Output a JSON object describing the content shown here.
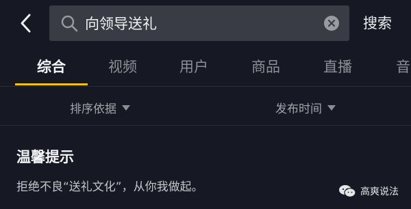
{
  "search": {
    "query": "向领导送礼",
    "button_label": "搜索"
  },
  "tabs": [
    {
      "label": "综合",
      "active": true
    },
    {
      "label": "视频",
      "active": false
    },
    {
      "label": "用户",
      "active": false
    },
    {
      "label": "商品",
      "active": false
    },
    {
      "label": "直播",
      "active": false
    },
    {
      "label": "音",
      "active": false
    }
  ],
  "filters": {
    "sort_label": "排序依据",
    "time_label": "发布时间"
  },
  "notice": {
    "title": "温馨提示",
    "text": "拒绝不良“送礼文化”，从你我做起。"
  },
  "watermark": {
    "account_name": "高爽说法",
    "icon": "wechat-icon"
  },
  "colors": {
    "background": "#161823",
    "accent_underline": "#f4c21a",
    "search_box": "#3a3c45"
  }
}
